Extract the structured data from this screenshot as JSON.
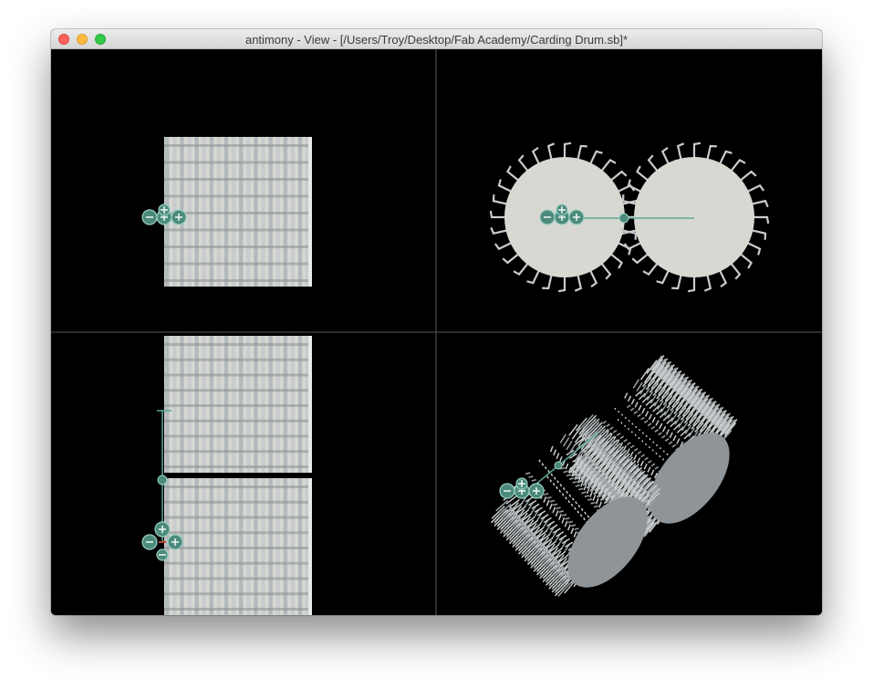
{
  "window": {
    "title": "antimony - View - [/Users/Troy/Desktop/Fab Academy/Carding Drum.sb]*"
  },
  "viewports": [
    {
      "name": "front-view"
    },
    {
      "name": "top-view"
    },
    {
      "name": "side-view"
    },
    {
      "name": "3d-view"
    }
  ],
  "colors": {
    "background": "#000000",
    "divider": "#3a3a3a",
    "drum_fill": "#d8d8d2",
    "tooth_light": "#c8cccc",
    "tooth_dark": "#8a9096",
    "handle": "#4c8a7c",
    "handle_border": "#9ad0c4",
    "handle_line": "#5aa898"
  },
  "icons": [
    "minus-icon",
    "plus-icon",
    "close-icon",
    "minimize-icon",
    "maximize-icon"
  ]
}
